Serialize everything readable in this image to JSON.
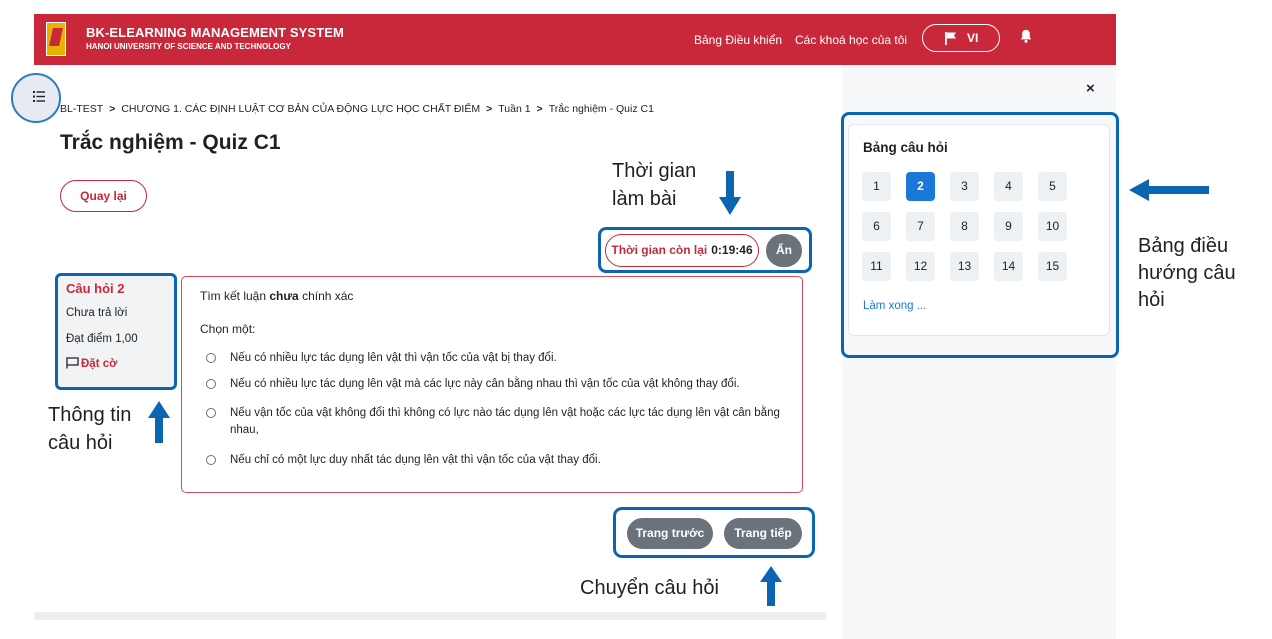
{
  "header": {
    "brand_title": "BK-ELEARNING MANAGEMENT SYSTEM",
    "brand_subtitle": "HANOI UNIVERSITY OF SCIENCE AND TECHNOLOGY",
    "nav_dashboard": "Bảng Điều khiển",
    "nav_my_courses": "Các khoá học của tôi",
    "language": "VI"
  },
  "breadcrumb": [
    "BL-TEST",
    "CHƯƠNG 1. CÁC ĐỊNH LUẬT CƠ BẢN CỦA ĐỘNG LỰC HỌC CHẤT ĐIỂM",
    "Tuần 1",
    "Trắc nghiệm - Quiz C1"
  ],
  "page_title": "Trắc nghiệm - Quiz C1",
  "back_label": "Quay lại",
  "timer": {
    "label": "Thời gian còn lại",
    "value": "0:19:46",
    "hide_label": "Ẩn"
  },
  "question_info": {
    "title": "Câu hỏi 2",
    "status": "Chưa trả lời",
    "mark": "Đạt điểm 1,00",
    "flag_label": "Đặt cờ"
  },
  "question": {
    "text_before": "Tìm kết luận ",
    "text_bold": "chưa",
    "text_after": " chính xác",
    "prompt": "Chọn một:",
    "options": [
      "Nếu có nhiều lực tác dụng lên vật thì vận tốc của vật bị thay đổi.",
      "Nếu có nhiều lực tác dụng lên vật mà các lực này cân bằng nhau thì vận tốc của vật không thay đổi.",
      "Nếu vận tốc của vật không đổi thì không có lực nào tác dụng lên vật hoặc các lực tác dụng lên vật cân bằng nhau,",
      "Nếu chỉ có một lực duy nhất tác dụng lên vật thì vận tốc của vật thay đổi."
    ]
  },
  "nav_buttons": {
    "prev": "Trang trước",
    "next": "Trang tiếp"
  },
  "quiz_nav": {
    "title": "Bảng câu hỏi",
    "numbers": [
      "1",
      "2",
      "3",
      "4",
      "5",
      "6",
      "7",
      "8",
      "9",
      "10",
      "11",
      "12",
      "13",
      "14",
      "15"
    ],
    "current": "2",
    "finish": "Làm xong ..."
  },
  "close_symbol": "×",
  "annotations": {
    "time_line1": "Thời gian",
    "time_line2": "làm bài",
    "nav_panel_line1": "Bảng điều",
    "nav_panel_line2": "hướng câu",
    "nav_panel_line3": "hỏi",
    "qinfo_line1": "Thông tin",
    "qinfo_line2": "câu hỏi",
    "move_question": "Chuyển câu hỏi"
  },
  "colors": {
    "brand": "#c8283a",
    "annotation": "#0b65b2",
    "current_question": "#1b78d9",
    "button_grey": "#6a737b"
  }
}
